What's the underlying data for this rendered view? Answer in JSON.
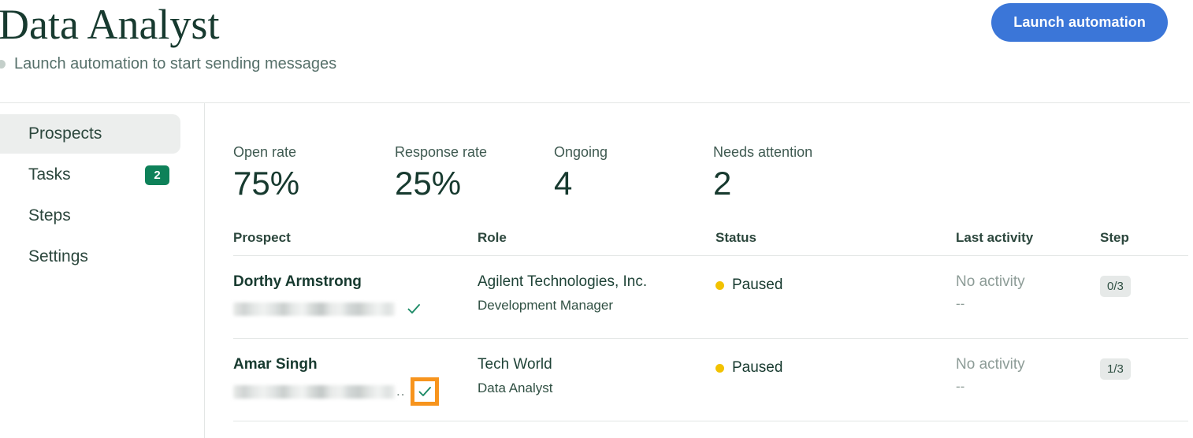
{
  "header": {
    "title": "Data Analyst",
    "subtitle": "Launch automation to start sending messages",
    "launch_button": "Launch automation",
    "accent_blue": "#3b76d8",
    "title_green": "#173a2f",
    "subtitle_dot_color": "#c4cfca"
  },
  "sidebar": {
    "items": [
      {
        "label": "Prospects",
        "badge": "",
        "active": true
      },
      {
        "label": "Tasks",
        "badge": "2",
        "active": false
      },
      {
        "label": "Steps",
        "badge": "",
        "active": false
      },
      {
        "label": "Settings",
        "badge": "",
        "active": false
      }
    ],
    "badge_color": "#0e8159",
    "active_bg": "#eceeed"
  },
  "stats": [
    {
      "label": "Open rate",
      "value": "75%"
    },
    {
      "label": "Response rate",
      "value": "25%"
    },
    {
      "label": "Ongoing",
      "value": "4"
    },
    {
      "label": "Needs attention",
      "value": "2"
    }
  ],
  "table": {
    "columns": [
      "Prospect",
      "Role",
      "Status",
      "Last activity",
      "Step"
    ],
    "rows": [
      {
        "name": "Dorthy Armstrong",
        "email_redacted": true,
        "email_ellipsis": "",
        "verified_icon": "check-icon",
        "verified_focused": false,
        "company": "Agilent Technologies, Inc.",
        "title": "Development Manager",
        "status": "Paused",
        "status_dot_color": "#f2c200",
        "last_activity": "No activity",
        "last_activity_sub": "--",
        "step": "0/3"
      },
      {
        "name": "Amar Singh",
        "email_redacted": true,
        "email_ellipsis": "..",
        "verified_icon": "check-icon",
        "verified_focused": true,
        "company": "Tech World",
        "title": "Data Analyst",
        "status": "Paused",
        "status_dot_color": "#f2c200",
        "last_activity": "No activity",
        "last_activity_sub": "--",
        "step": "1/3"
      }
    ],
    "focus_ring_color": "#f7941d",
    "check_color": "#1c8a66"
  }
}
